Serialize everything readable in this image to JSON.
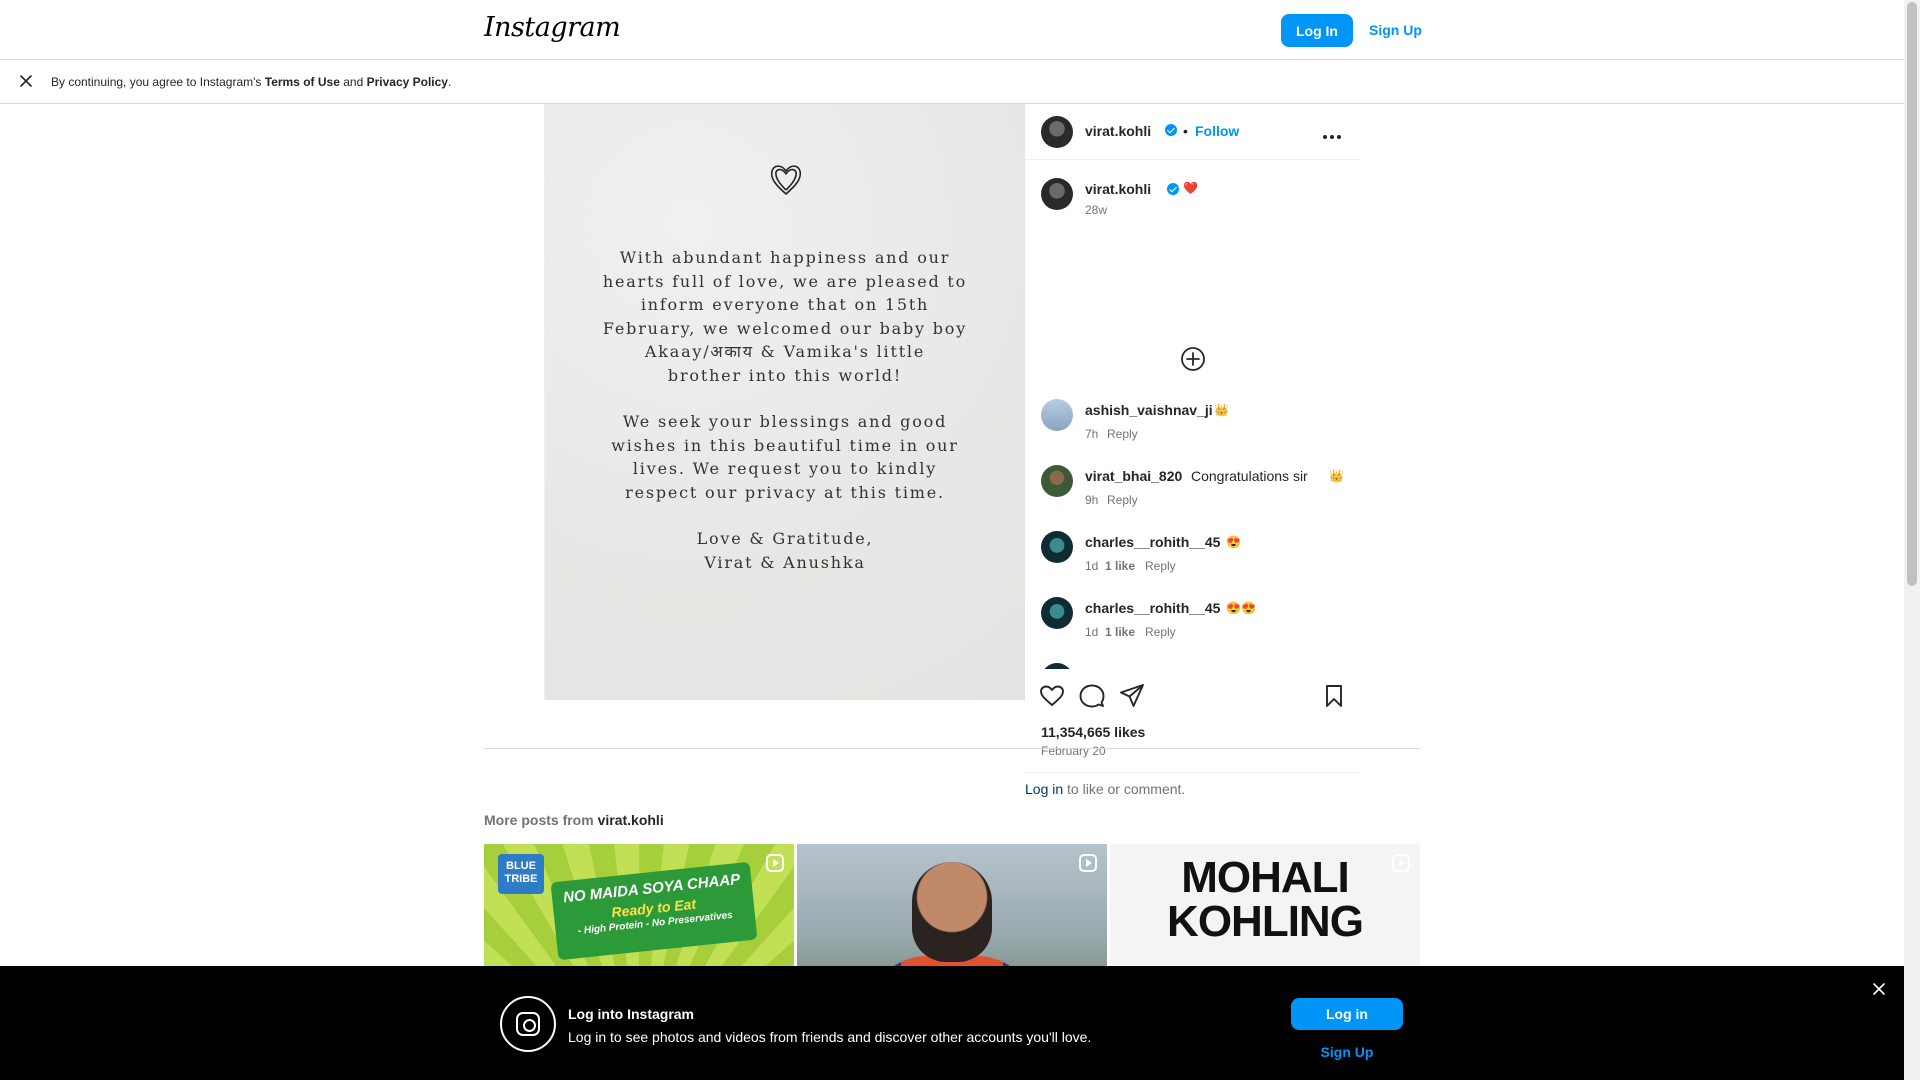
{
  "nav": {
    "logo": "Instagram",
    "login_label": "Log In",
    "signup_label": "Sign Up"
  },
  "consent": {
    "prefix": "By continuing, you agree to Instagram's ",
    "terms": "Terms of Use",
    "and": " and ",
    "privacy": "Privacy Policy",
    "suffix": "."
  },
  "post": {
    "image_text": {
      "para1": [
        "With abundant happiness and our",
        "hearts full of love, we are pleased to",
        "inform everyone that on 15th",
        "February, we welcomed our baby boy",
        "Akaay/अकाय & Vamika's little",
        "brother into this world!"
      ],
      "para2": [
        "We seek your blessings and good",
        "wishes in this beautiful time in our",
        "lives. We request you to kindly",
        "respect our privacy at this time."
      ],
      "para3": [
        "Love & Gratitude,",
        "Virat & Anushka"
      ]
    },
    "author": "virat.kohli",
    "dot": "•",
    "follow_label": "Follow",
    "caption": {
      "user": "virat.kohli",
      "emoji": "❤️",
      "age": "28w"
    },
    "comments": [
      {
        "user": "ashish_vaishnav_ji",
        "text": "",
        "emoji": "👑",
        "age": "7h",
        "likes": "",
        "reply": "Reply"
      },
      {
        "user": "virat_bhai_820",
        "text": "Congratulations sir",
        "emoji": "👑",
        "age": "9h",
        "likes": "",
        "reply": "Reply"
      },
      {
        "user": "charles__rohith__45",
        "text": "",
        "emoji": "😍",
        "age": "1d",
        "likes": "1 like",
        "reply": "Reply"
      },
      {
        "user": "charles__rohith__45",
        "text": "",
        "emoji": "😍😍",
        "age": "1d",
        "likes": "1 like",
        "reply": "Reply"
      }
    ],
    "likes": "11,354,665 likes",
    "date": "February 20",
    "login_link": "Log in",
    "login_suffix": " to like or comment."
  },
  "more": {
    "prefix": "More posts from ",
    "user": "virat.kohli",
    "tiles": {
      "t1_brand": "BLUE TRIBE",
      "t1_line1": "NO MAIDA SOYA CHAAP",
      "t1_line2": "Ready to Eat",
      "t1_line3": "- High Protein - No Preservatives",
      "t3_title_1": "MOHALI",
      "t3_title_2": "KOHLING"
    }
  },
  "bottom": {
    "title": "Log into Instagram",
    "text": "Log in to see photos and videos from friends and discover other accounts you'll love.",
    "login_label": "Log in",
    "signup_label": "Sign Up"
  },
  "colors": {
    "accent": "#0095f6",
    "link_dark": "#00376b",
    "muted": "#737373",
    "border": "#dbdbdb"
  },
  "icons": [
    "close-icon",
    "heart-doodle-icon",
    "verified-icon",
    "more-options-icon",
    "add-circle-icon",
    "like-icon",
    "comment-icon",
    "share-icon",
    "save-icon",
    "reel-icon",
    "instagram-camera-icon"
  ]
}
